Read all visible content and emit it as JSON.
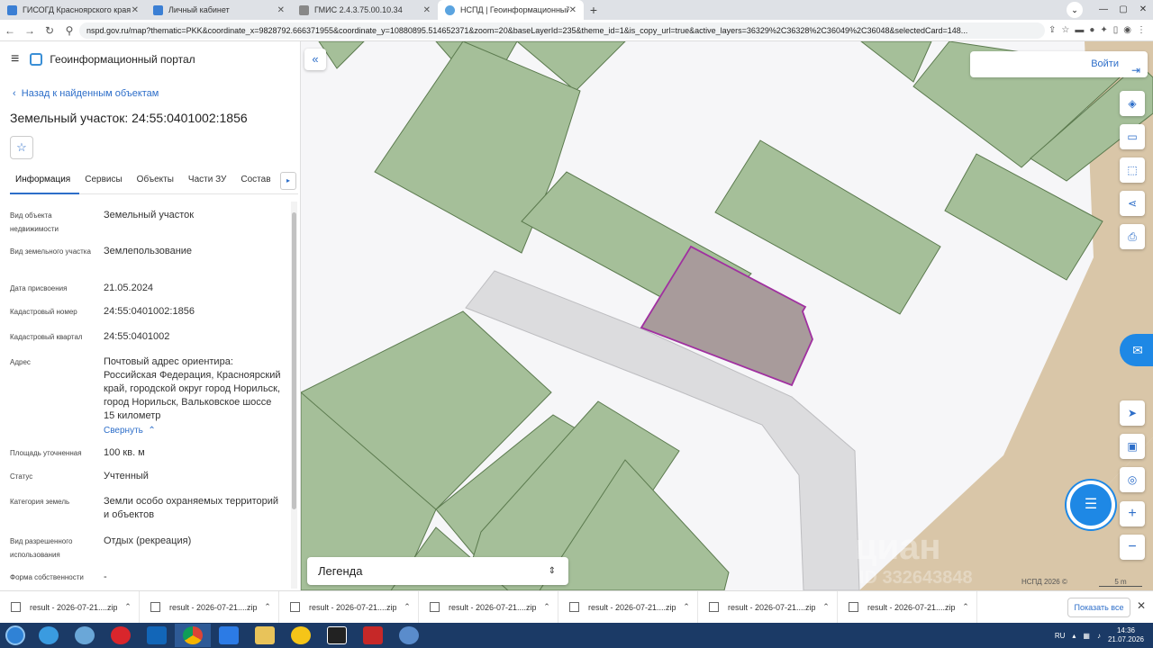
{
  "browser": {
    "tabs": [
      {
        "title": "ГИСОГД Красноярского края",
        "active": false
      },
      {
        "title": "Личный кабинет",
        "active": false
      },
      {
        "title": "ГМИС 2.4.3.75.00.10.34",
        "active": false
      },
      {
        "title": "НСПД | Геоинформационный п",
        "active": true
      }
    ],
    "url": "nspd.gov.ru/map?thematic=PKK&coordinate_x=9828792.666371955&coordinate_y=10880895.514652371&zoom=20&baseLayerId=235&theme_id=1&is_copy_url=true&active_layers=36329%2C36328%2C36049%2C36048&selectedCard=148..."
  },
  "portal": {
    "title": "Геоинформационный портал",
    "back_link": "Назад к найденным объектам",
    "object_title": "Земельный участок: 24:55:0401002:1856"
  },
  "tabs": [
    "Информация",
    "Сервисы",
    "Объекты",
    "Части ЗУ",
    "Состав"
  ],
  "properties": [
    {
      "label": "Вид объекта недвижимости",
      "value": "Земельный участок"
    },
    {
      "label": "Вид земельного участка",
      "value": "Землепользование"
    },
    {
      "label": "Дата присвоения",
      "value": "21.05.2024"
    },
    {
      "label": "Кадастровый номер",
      "value": "24:55:0401002:1856"
    },
    {
      "label": "Кадастровый квартал",
      "value": "24:55:0401002"
    },
    {
      "label": "Адрес",
      "value": "Почтовый адрес ориентира: Российская Федерация, Красноярский край, городской округ город Норильск, город Норильск, Вальковское шоссе 15 километр"
    },
    {
      "label": "Площадь уточненная",
      "value": "100 кв. м"
    },
    {
      "label": "Статус",
      "value": "Учтенный"
    },
    {
      "label": "Категория земель",
      "value": "Земли особо охраняемых территорий и объектов"
    },
    {
      "label": "Вид разрешенного использования",
      "value": "Отдых (рекреация)"
    },
    {
      "label": "Форма собственности",
      "value": "-"
    }
  ],
  "collapse_link": "Свернуть",
  "map": {
    "login": "Войти",
    "legend": "Легенда",
    "attribution": "НСПД 2026 ©",
    "scale": "5 m",
    "watermark": "циан",
    "watermark_id": "ID 332643848",
    "colors": {
      "parcel": "#a5bf99",
      "parcel_border": "#5b7a4e",
      "selected": "#a89b9b",
      "selected_border": "#a030a0",
      "road": "#dcdcde",
      "terrain": "#d9c6a8",
      "accent": "#2d6ec9"
    }
  },
  "downloads": {
    "items": [
      "result - 2026-07-21....zip",
      "result - 2026-07-21....zip",
      "result - 2026-07-21....zip",
      "result - 2026-07-21....zip",
      "result - 2026-07-21....zip",
      "result - 2026-07-21....zip",
      "result - 2026-07-21....zip"
    ],
    "show_all": "Показать все"
  },
  "taskbar": {
    "lang": "RU",
    "time": "14:36",
    "date": "21.07.2026"
  }
}
